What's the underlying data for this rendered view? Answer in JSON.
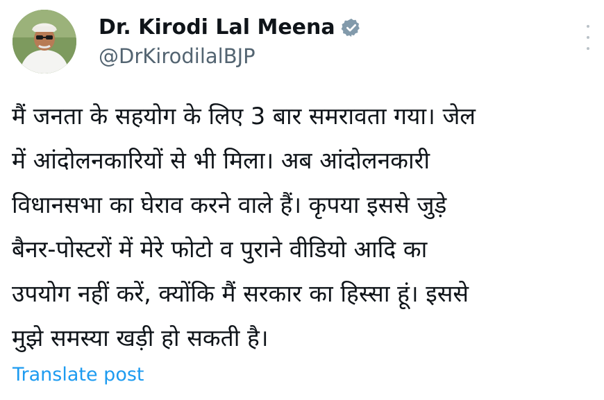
{
  "author": {
    "display_name": "Dr. Kirodi Lal Meena",
    "handle": "@DrKirodilalBJP",
    "verified": true,
    "avatar_icon": "profile-photo"
  },
  "post": {
    "lines": [
      "मैं जनता के सहयोग के लिए 3 बार समरावता गया। जेल",
      "में आंदोलनकारियों से भी मिला। अब आंदोलनकारी",
      "विधानसभा का घेराव करने वाले हैं। कृपया इससे जुड़े",
      "बैनर-पोस्टरों में मेरे फोटो व पुराने वीडियो आदि का",
      "उपयोग नहीं करें, क्योंकि मैं सरकार का हिस्सा हूं। इससे",
      "मुझे समस्या खड़ी हो सकती है।"
    ]
  },
  "actions": {
    "translate_label": "Translate post"
  },
  "colors": {
    "name": "#0f1419",
    "handle": "#536471",
    "link": "#1d9bf0",
    "badge": "#829aab",
    "more_dots": "#b9c1c7"
  }
}
